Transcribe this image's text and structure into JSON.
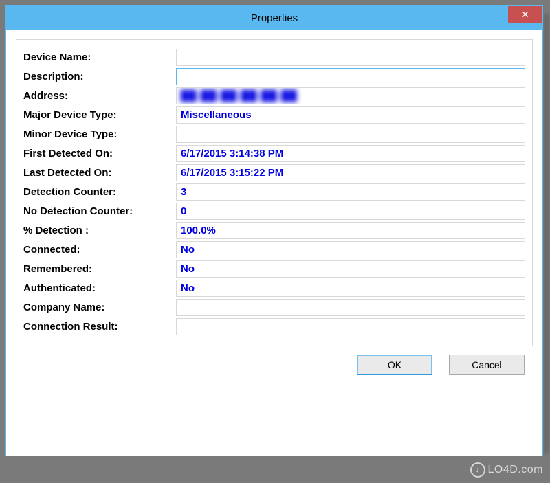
{
  "window": {
    "title": "Properties",
    "close_glyph": "✕"
  },
  "fields": {
    "device_name": {
      "label": "Device Name:",
      "value": ""
    },
    "description": {
      "label": "Description:",
      "value": ""
    },
    "address": {
      "label": "Address:",
      "value": "██:██:██:██:██:██"
    },
    "major_device_type": {
      "label": "Major Device Type:",
      "value": "Miscellaneous"
    },
    "minor_device_type": {
      "label": "Minor Device Type:",
      "value": ""
    },
    "first_detected_on": {
      "label": "First Detected On:",
      "value": "6/17/2015 3:14:38 PM"
    },
    "last_detected_on": {
      "label": "Last Detected On:",
      "value": "6/17/2015 3:15:22 PM"
    },
    "detection_counter": {
      "label": "Detection Counter:",
      "value": "3"
    },
    "no_detection_counter": {
      "label": "No Detection Counter:",
      "value": "0"
    },
    "percent_detection": {
      "label": "% Detection :",
      "value": "100.0%"
    },
    "connected": {
      "label": "Connected:",
      "value": "No"
    },
    "remembered": {
      "label": "Remembered:",
      "value": "No"
    },
    "authenticated": {
      "label": "Authenticated:",
      "value": "No"
    },
    "company_name": {
      "label": "Company Name:",
      "value": ""
    },
    "connection_result": {
      "label": "Connection Result:",
      "value": ""
    }
  },
  "buttons": {
    "ok": "OK",
    "cancel": "Cancel"
  },
  "watermark": "LO4D.com"
}
